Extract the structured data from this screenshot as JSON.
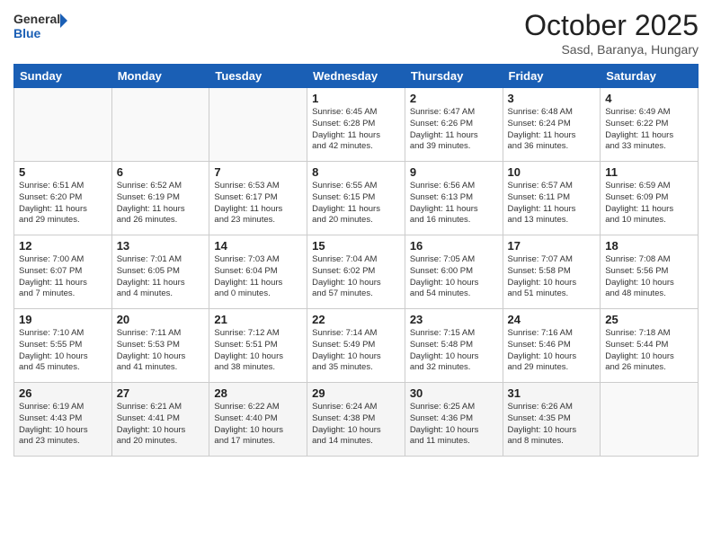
{
  "header": {
    "logo_general": "General",
    "logo_blue": "Blue",
    "month_title": "October 2025",
    "subtitle": "Sasd, Baranya, Hungary"
  },
  "weekdays": [
    "Sunday",
    "Monday",
    "Tuesday",
    "Wednesday",
    "Thursday",
    "Friday",
    "Saturday"
  ],
  "weeks": [
    [
      {
        "day": "",
        "info": ""
      },
      {
        "day": "",
        "info": ""
      },
      {
        "day": "",
        "info": ""
      },
      {
        "day": "1",
        "info": "Sunrise: 6:45 AM\nSunset: 6:28 PM\nDaylight: 11 hours\nand 42 minutes."
      },
      {
        "day": "2",
        "info": "Sunrise: 6:47 AM\nSunset: 6:26 PM\nDaylight: 11 hours\nand 39 minutes."
      },
      {
        "day": "3",
        "info": "Sunrise: 6:48 AM\nSunset: 6:24 PM\nDaylight: 11 hours\nand 36 minutes."
      },
      {
        "day": "4",
        "info": "Sunrise: 6:49 AM\nSunset: 6:22 PM\nDaylight: 11 hours\nand 33 minutes."
      }
    ],
    [
      {
        "day": "5",
        "info": "Sunrise: 6:51 AM\nSunset: 6:20 PM\nDaylight: 11 hours\nand 29 minutes."
      },
      {
        "day": "6",
        "info": "Sunrise: 6:52 AM\nSunset: 6:19 PM\nDaylight: 11 hours\nand 26 minutes."
      },
      {
        "day": "7",
        "info": "Sunrise: 6:53 AM\nSunset: 6:17 PM\nDaylight: 11 hours\nand 23 minutes."
      },
      {
        "day": "8",
        "info": "Sunrise: 6:55 AM\nSunset: 6:15 PM\nDaylight: 11 hours\nand 20 minutes."
      },
      {
        "day": "9",
        "info": "Sunrise: 6:56 AM\nSunset: 6:13 PM\nDaylight: 11 hours\nand 16 minutes."
      },
      {
        "day": "10",
        "info": "Sunrise: 6:57 AM\nSunset: 6:11 PM\nDaylight: 11 hours\nand 13 minutes."
      },
      {
        "day": "11",
        "info": "Sunrise: 6:59 AM\nSunset: 6:09 PM\nDaylight: 11 hours\nand 10 minutes."
      }
    ],
    [
      {
        "day": "12",
        "info": "Sunrise: 7:00 AM\nSunset: 6:07 PM\nDaylight: 11 hours\nand 7 minutes."
      },
      {
        "day": "13",
        "info": "Sunrise: 7:01 AM\nSunset: 6:05 PM\nDaylight: 11 hours\nand 4 minutes."
      },
      {
        "day": "14",
        "info": "Sunrise: 7:03 AM\nSunset: 6:04 PM\nDaylight: 11 hours\nand 0 minutes."
      },
      {
        "day": "15",
        "info": "Sunrise: 7:04 AM\nSunset: 6:02 PM\nDaylight: 10 hours\nand 57 minutes."
      },
      {
        "day": "16",
        "info": "Sunrise: 7:05 AM\nSunset: 6:00 PM\nDaylight: 10 hours\nand 54 minutes."
      },
      {
        "day": "17",
        "info": "Sunrise: 7:07 AM\nSunset: 5:58 PM\nDaylight: 10 hours\nand 51 minutes."
      },
      {
        "day": "18",
        "info": "Sunrise: 7:08 AM\nSunset: 5:56 PM\nDaylight: 10 hours\nand 48 minutes."
      }
    ],
    [
      {
        "day": "19",
        "info": "Sunrise: 7:10 AM\nSunset: 5:55 PM\nDaylight: 10 hours\nand 45 minutes."
      },
      {
        "day": "20",
        "info": "Sunrise: 7:11 AM\nSunset: 5:53 PM\nDaylight: 10 hours\nand 41 minutes."
      },
      {
        "day": "21",
        "info": "Sunrise: 7:12 AM\nSunset: 5:51 PM\nDaylight: 10 hours\nand 38 minutes."
      },
      {
        "day": "22",
        "info": "Sunrise: 7:14 AM\nSunset: 5:49 PM\nDaylight: 10 hours\nand 35 minutes."
      },
      {
        "day": "23",
        "info": "Sunrise: 7:15 AM\nSunset: 5:48 PM\nDaylight: 10 hours\nand 32 minutes."
      },
      {
        "day": "24",
        "info": "Sunrise: 7:16 AM\nSunset: 5:46 PM\nDaylight: 10 hours\nand 29 minutes."
      },
      {
        "day": "25",
        "info": "Sunrise: 7:18 AM\nSunset: 5:44 PM\nDaylight: 10 hours\nand 26 minutes."
      }
    ],
    [
      {
        "day": "26",
        "info": "Sunrise: 6:19 AM\nSunset: 4:43 PM\nDaylight: 10 hours\nand 23 minutes."
      },
      {
        "day": "27",
        "info": "Sunrise: 6:21 AM\nSunset: 4:41 PM\nDaylight: 10 hours\nand 20 minutes."
      },
      {
        "day": "28",
        "info": "Sunrise: 6:22 AM\nSunset: 4:40 PM\nDaylight: 10 hours\nand 17 minutes."
      },
      {
        "day": "29",
        "info": "Sunrise: 6:24 AM\nSunset: 4:38 PM\nDaylight: 10 hours\nand 14 minutes."
      },
      {
        "day": "30",
        "info": "Sunrise: 6:25 AM\nSunset: 4:36 PM\nDaylight: 10 hours\nand 11 minutes."
      },
      {
        "day": "31",
        "info": "Sunrise: 6:26 AM\nSunset: 4:35 PM\nDaylight: 10 hours\nand 8 minutes."
      },
      {
        "day": "",
        "info": ""
      }
    ]
  ]
}
